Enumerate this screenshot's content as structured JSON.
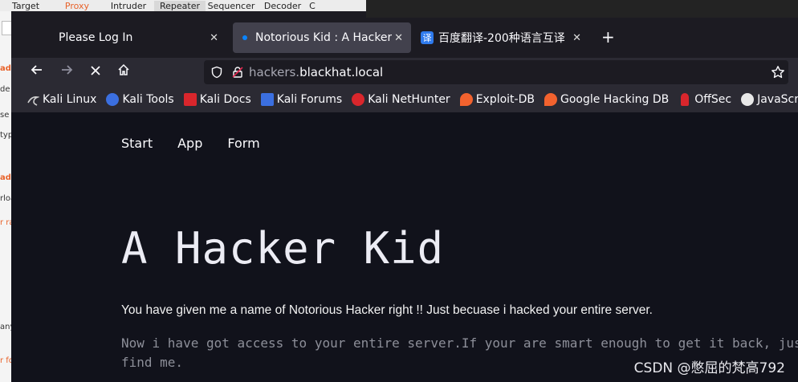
{
  "burp": {
    "tabs": [
      "Target",
      "Proxy",
      "Intruder",
      "Repeater",
      "Sequencer",
      "Decoder",
      "C"
    ],
    "active_tab": "Proxy",
    "side_fragments": [
      "ad",
      "de",
      "se",
      "typ",
      "ad",
      "rloa",
      "r ra",
      "any",
      "r fo"
    ]
  },
  "browser": {
    "tabs": [
      {
        "title": "Please Log In",
        "active": false
      },
      {
        "title": "Notorious Kid : A Hacker",
        "active": true
      },
      {
        "title": "百度翻译-200种语言互译",
        "active": false,
        "icon_text": "译"
      }
    ],
    "url_prefix": "hackers.",
    "url_domain": "blackhat.local",
    "bookmarks": [
      {
        "label": "Kali Linux",
        "icon": "kali-dragon-icon",
        "color": "#cfcfcf"
      },
      {
        "label": "Kali Tools",
        "icon": "kali-tools-icon",
        "color": "#3b6fe0"
      },
      {
        "label": "Kali Docs",
        "icon": "kali-docs-icon",
        "color": "#d9262c"
      },
      {
        "label": "Kali Forums",
        "icon": "kali-forums-icon",
        "color": "#3b6fe0"
      },
      {
        "label": "Kali NetHunter",
        "icon": "nethunter-icon",
        "color": "#d9262c"
      },
      {
        "label": "Exploit-DB",
        "icon": "exploitdb-icon",
        "color": "#f2622e"
      },
      {
        "label": "Google Hacking DB",
        "icon": "ghdb-icon",
        "color": "#f2622e"
      },
      {
        "label": "OffSec",
        "icon": "offsec-icon",
        "color": "#d9262c"
      },
      {
        "label": "JavaScript Be",
        "icon": "js-chef-icon",
        "color": "#e8e8e8"
      }
    ]
  },
  "page": {
    "nav": [
      "Start",
      "App",
      "Form"
    ],
    "heading": "A Hacker Kid",
    "paragraph1": "You have given me a name of Notorious Hacker right !! Just becuase i hacked your entire server.",
    "paragraph2": "Now i have got access to your entire server.If your are smart enough to get it back, just find me."
  },
  "watermark": "CSDN @憋屈的梵高792"
}
